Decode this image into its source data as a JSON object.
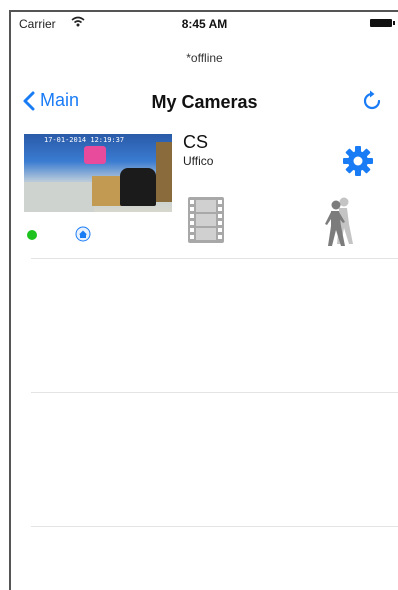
{
  "status_bar": {
    "carrier": "Carrier",
    "time": "8:45 AM"
  },
  "sub_status": "*offline",
  "nav": {
    "back_label": "Main",
    "title": "My Cameras"
  },
  "camera": {
    "name": "CS",
    "location": "Uffico",
    "status": "online",
    "thumbnail_timestamp": "17-01-2014 12:19:37"
  },
  "colors": {
    "accent": "#1a7cf5",
    "online": "#1ec21e",
    "icon_gray": "#8a8a8a"
  },
  "icons": {
    "back": "chevron-left",
    "refresh": "refresh",
    "settings": "gear",
    "recordings": "film-strip",
    "motion": "walking-person",
    "location": "home"
  }
}
